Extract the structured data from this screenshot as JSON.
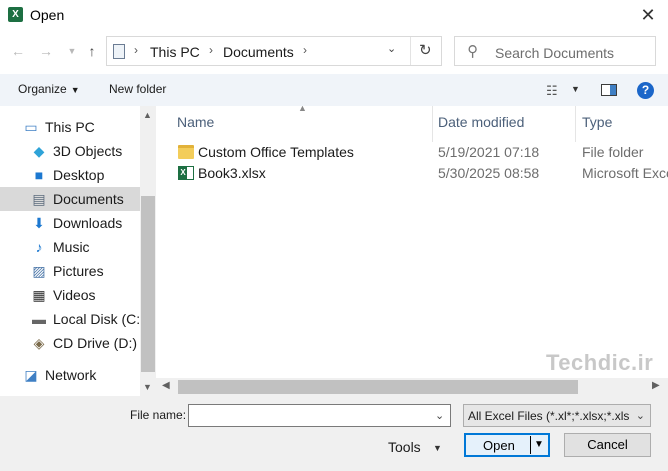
{
  "window": {
    "title": "Open",
    "app_icon": "excel-icon",
    "close_label": "✕"
  },
  "address_bar": {
    "segments": [
      "This PC",
      "Documents"
    ]
  },
  "search": {
    "placeholder": "Search Documents"
  },
  "toolbar": {
    "organize_label": "Organize",
    "new_folder_label": "New folder"
  },
  "nav_tree": {
    "items": [
      {
        "label": "This PC",
        "icon": "computer-icon"
      },
      {
        "label": "3D Objects",
        "icon": "cube-icon"
      },
      {
        "label": "Desktop",
        "icon": "desktop-icon"
      },
      {
        "label": "Documents",
        "icon": "document-icon",
        "selected": true
      },
      {
        "label": "Downloads",
        "icon": "download-arrow-icon"
      },
      {
        "label": "Music",
        "icon": "music-note-icon"
      },
      {
        "label": "Pictures",
        "icon": "picture-icon"
      },
      {
        "label": "Videos",
        "icon": "film-icon"
      },
      {
        "label": "Local Disk (C:)",
        "icon": "drive-icon"
      },
      {
        "label": "CD Drive (D:) V",
        "icon": "cd-drive-icon"
      },
      {
        "label": "Network",
        "icon": "network-icon"
      }
    ]
  },
  "file_list": {
    "columns": {
      "name": "Name",
      "date": "Date modified",
      "type": "Type"
    },
    "rows": [
      {
        "name": "Custom Office Templates",
        "date": "5/19/2021 07:18",
        "type": "File folder",
        "icon": "folder-icon"
      },
      {
        "name": "Book3.xlsx",
        "date": "5/30/2025 08:58",
        "type": "Microsoft Excel",
        "icon": "excel-file-icon"
      }
    ]
  },
  "watermark": "Techdic.ir",
  "bottom": {
    "file_name_label": "File name:",
    "file_name_value": "",
    "filter_value": "All Excel Files (*.xl*;*.xlsx;*.xlsm",
    "tools_label": "Tools",
    "open_label": "Open",
    "cancel_label": "Cancel"
  },
  "colors": {
    "toolbar_bg": "#f0f4f9",
    "selected_bg": "#d9d9d9",
    "accent": "#0078d7",
    "excel_green": "#1d6f42"
  }
}
